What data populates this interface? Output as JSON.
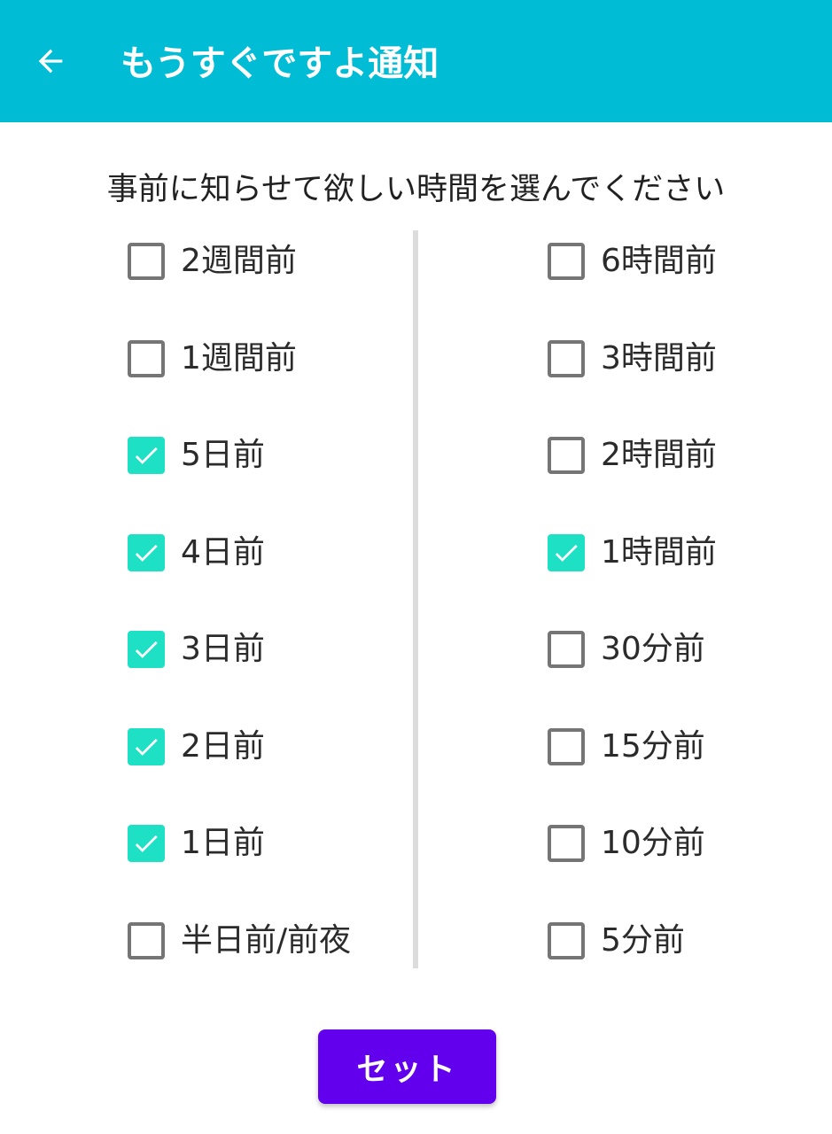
{
  "appbar": {
    "title": "もうすぐですよ通知",
    "back_icon": "arrow-left-icon",
    "color": "#00bcd4"
  },
  "prompt": "事前に知らせて欲しい時間を選んでください",
  "left_options": [
    {
      "label": "2週間前",
      "checked": false
    },
    {
      "label": "1週間前",
      "checked": false
    },
    {
      "label": "5日前",
      "checked": true
    },
    {
      "label": "4日前",
      "checked": true
    },
    {
      "label": "3日前",
      "checked": true
    },
    {
      "label": "2日前",
      "checked": true
    },
    {
      "label": "1日前",
      "checked": true
    },
    {
      "label": "半日前/前夜",
      "checked": false
    }
  ],
  "right_options": [
    {
      "label": "6時間前",
      "checked": false
    },
    {
      "label": "3時間前",
      "checked": false
    },
    {
      "label": "2時間前",
      "checked": false
    },
    {
      "label": "1時間前",
      "checked": true
    },
    {
      "label": "30分前",
      "checked": false
    },
    {
      "label": "15分前",
      "checked": false
    },
    {
      "label": "10分前",
      "checked": false
    },
    {
      "label": "5分前",
      "checked": false
    }
  ],
  "set_button": {
    "label": "セット",
    "color": "#6200ee"
  },
  "colors": {
    "checked": "#1de0c4",
    "unchecked_border": "#757575"
  }
}
